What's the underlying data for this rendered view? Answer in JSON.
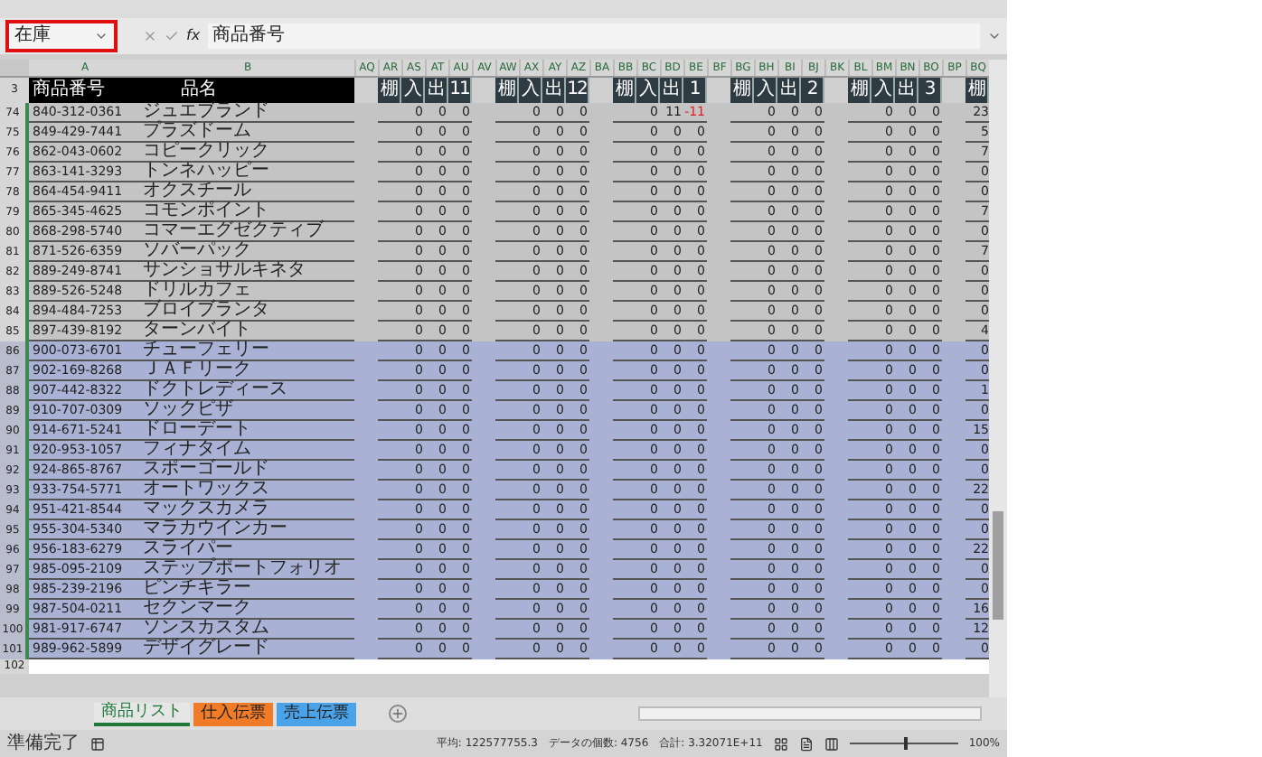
{
  "name_box": "在庫",
  "formula": {
    "fx": "fx",
    "value": "商品番号"
  },
  "columns": [
    "A",
    "B",
    "AQ",
    "AR",
    "AS",
    "AT",
    "AU",
    "AV",
    "AW",
    "AX",
    "AY",
    "AZ",
    "BA",
    "BB",
    "BC",
    "BD",
    "BE",
    "BF",
    "BG",
    "BH",
    "BI",
    "BJ",
    "BK",
    "BL",
    "BM",
    "BN",
    "BO",
    "BP",
    "BQ"
  ],
  "header": {
    "row": "3",
    "code": "商品番号",
    "name": "品名",
    "groups": [
      [
        "棚",
        "入",
        "出",
        "11"
      ],
      [
        "棚",
        "入",
        "出",
        "12"
      ],
      [
        "棚",
        "入",
        "出",
        "1"
      ],
      [
        "棚",
        "入",
        "出",
        "2"
      ],
      [
        "棚",
        "入",
        "出",
        "3"
      ]
    ],
    "last": "棚"
  },
  "rows": [
    {
      "num": "74",
      "code": "840-312-0361",
      "name": "ジュエブランド",
      "selected": false,
      "values": [
        [
          "0",
          "0",
          "0"
        ],
        [
          "0",
          "0",
          "0"
        ],
        [
          "0",
          "11",
          "-11"
        ],
        [
          "0",
          "0",
          "0"
        ],
        [
          "0",
          "0",
          "0"
        ]
      ],
      "red_values": [
        false,
        false,
        false,
        false,
        false,
        false,
        false,
        false,
        true,
        false,
        false,
        false,
        false,
        false,
        false
      ],
      "last": "23"
    },
    {
      "num": "75",
      "code": "849-429-7441",
      "name": "プラズドーム",
      "selected": false,
      "values": [
        [
          "0",
          "0",
          "0"
        ],
        [
          "0",
          "0",
          "0"
        ],
        [
          "0",
          "0",
          "0"
        ],
        [
          "0",
          "0",
          "0"
        ],
        [
          "0",
          "0",
          "0"
        ]
      ],
      "last": "5"
    },
    {
      "num": "76",
      "code": "862-043-0602",
      "name": "コピークリック",
      "selected": false,
      "values": [
        [
          "0",
          "0",
          "0"
        ],
        [
          "0",
          "0",
          "0"
        ],
        [
          "0",
          "0",
          "0"
        ],
        [
          "0",
          "0",
          "0"
        ],
        [
          "0",
          "0",
          "0"
        ]
      ],
      "last": "7"
    },
    {
      "num": "77",
      "code": "863-141-3293",
      "name": "トンネハッピー",
      "selected": false,
      "values": [
        [
          "0",
          "0",
          "0"
        ],
        [
          "0",
          "0",
          "0"
        ],
        [
          "0",
          "0",
          "0"
        ],
        [
          "0",
          "0",
          "0"
        ],
        [
          "0",
          "0",
          "0"
        ]
      ],
      "last": "0"
    },
    {
      "num": "78",
      "code": "864-454-9411",
      "name": "オクスチール",
      "selected": false,
      "values": [
        [
          "0",
          "0",
          "0"
        ],
        [
          "0",
          "0",
          "0"
        ],
        [
          "0",
          "0",
          "0"
        ],
        [
          "0",
          "0",
          "0"
        ],
        [
          "0",
          "0",
          "0"
        ]
      ],
      "last": "0"
    },
    {
      "num": "79",
      "code": "865-345-4625",
      "name": "コモンポイント",
      "selected": false,
      "values": [
        [
          "0",
          "0",
          "0"
        ],
        [
          "0",
          "0",
          "0"
        ],
        [
          "0",
          "0",
          "0"
        ],
        [
          "0",
          "0",
          "0"
        ],
        [
          "0",
          "0",
          "0"
        ]
      ],
      "last": "7"
    },
    {
      "num": "80",
      "code": "868-298-5740",
      "name": "コマーエグゼクティブ",
      "selected": false,
      "values": [
        [
          "0",
          "0",
          "0"
        ],
        [
          "0",
          "0",
          "0"
        ],
        [
          "0",
          "0",
          "0"
        ],
        [
          "0",
          "0",
          "0"
        ],
        [
          "0",
          "0",
          "0"
        ]
      ],
      "last": "0"
    },
    {
      "num": "81",
      "code": "871-526-6359",
      "name": "ソバーパック",
      "selected": false,
      "values": [
        [
          "0",
          "0",
          "0"
        ],
        [
          "0",
          "0",
          "0"
        ],
        [
          "0",
          "0",
          "0"
        ],
        [
          "0",
          "0",
          "0"
        ],
        [
          "0",
          "0",
          "0"
        ]
      ],
      "last": "7"
    },
    {
      "num": "82",
      "code": "889-249-8741",
      "name": "サンショサルキネタ",
      "selected": false,
      "values": [
        [
          "0",
          "0",
          "0"
        ],
        [
          "0",
          "0",
          "0"
        ],
        [
          "0",
          "0",
          "0"
        ],
        [
          "0",
          "0",
          "0"
        ],
        [
          "0",
          "0",
          "0"
        ]
      ],
      "last": "0"
    },
    {
      "num": "83",
      "code": "889-526-5248",
      "name": "ドリルカフェ",
      "selected": false,
      "values": [
        [
          "0",
          "0",
          "0"
        ],
        [
          "0",
          "0",
          "0"
        ],
        [
          "0",
          "0",
          "0"
        ],
        [
          "0",
          "0",
          "0"
        ],
        [
          "0",
          "0",
          "0"
        ]
      ],
      "last": "0"
    },
    {
      "num": "84",
      "code": "894-484-7253",
      "name": "ブロイブランタ",
      "selected": false,
      "values": [
        [
          "0",
          "0",
          "0"
        ],
        [
          "0",
          "0",
          "0"
        ],
        [
          "0",
          "0",
          "0"
        ],
        [
          "0",
          "0",
          "0"
        ],
        [
          "0",
          "0",
          "0"
        ]
      ],
      "last": "0"
    },
    {
      "num": "85",
      "code": "897-439-8192",
      "name": "ターンバイト",
      "selected": false,
      "values": [
        [
          "0",
          "0",
          "0"
        ],
        [
          "0",
          "0",
          "0"
        ],
        [
          "0",
          "0",
          "0"
        ],
        [
          "0",
          "0",
          "0"
        ],
        [
          "0",
          "0",
          "0"
        ]
      ],
      "last": "4"
    },
    {
      "num": "86",
      "code": "900-073-6701",
      "name": "チューフェリー",
      "selected": true,
      "values": [
        [
          "0",
          "0",
          "0"
        ],
        [
          "0",
          "0",
          "0"
        ],
        [
          "0",
          "0",
          "0"
        ],
        [
          "0",
          "0",
          "0"
        ],
        [
          "0",
          "0",
          "0"
        ]
      ],
      "last": "0"
    },
    {
      "num": "87",
      "code": "902-169-8268",
      "name": "ＪＡＦリーク",
      "selected": true,
      "values": [
        [
          "0",
          "0",
          "0"
        ],
        [
          "0",
          "0",
          "0"
        ],
        [
          "0",
          "0",
          "0"
        ],
        [
          "0",
          "0",
          "0"
        ],
        [
          "0",
          "0",
          "0"
        ]
      ],
      "last": "0"
    },
    {
      "num": "88",
      "code": "907-442-8322",
      "name": "ドクトレディース",
      "selected": true,
      "values": [
        [
          "0",
          "0",
          "0"
        ],
        [
          "0",
          "0",
          "0"
        ],
        [
          "0",
          "0",
          "0"
        ],
        [
          "0",
          "0",
          "0"
        ],
        [
          "0",
          "0",
          "0"
        ]
      ],
      "last": "1"
    },
    {
      "num": "89",
      "code": "910-707-0309",
      "name": "ソックピザ",
      "selected": true,
      "values": [
        [
          "0",
          "0",
          "0"
        ],
        [
          "0",
          "0",
          "0"
        ],
        [
          "0",
          "0",
          "0"
        ],
        [
          "0",
          "0",
          "0"
        ],
        [
          "0",
          "0",
          "0"
        ]
      ],
      "last": "0"
    },
    {
      "num": "90",
      "code": "914-671-5241",
      "name": "ドローデート",
      "selected": true,
      "values": [
        [
          "0",
          "0",
          "0"
        ],
        [
          "0",
          "0",
          "0"
        ],
        [
          "0",
          "0",
          "0"
        ],
        [
          "0",
          "0",
          "0"
        ],
        [
          "0",
          "0",
          "0"
        ]
      ],
      "last": "15"
    },
    {
      "num": "91",
      "code": "920-953-1057",
      "name": "フィナタイム",
      "selected": true,
      "values": [
        [
          "0",
          "0",
          "0"
        ],
        [
          "0",
          "0",
          "0"
        ],
        [
          "0",
          "0",
          "0"
        ],
        [
          "0",
          "0",
          "0"
        ],
        [
          "0",
          "0",
          "0"
        ]
      ],
      "last": "0"
    },
    {
      "num": "92",
      "code": "924-865-8767",
      "name": "スポーゴールド",
      "selected": true,
      "values": [
        [
          "0",
          "0",
          "0"
        ],
        [
          "0",
          "0",
          "0"
        ],
        [
          "0",
          "0",
          "0"
        ],
        [
          "0",
          "0",
          "0"
        ],
        [
          "0",
          "0",
          "0"
        ]
      ],
      "last": "0"
    },
    {
      "num": "93",
      "code": "933-754-5771",
      "name": "オートワックス",
      "selected": true,
      "values": [
        [
          "0",
          "0",
          "0"
        ],
        [
          "0",
          "0",
          "0"
        ],
        [
          "0",
          "0",
          "0"
        ],
        [
          "0",
          "0",
          "0"
        ],
        [
          "0",
          "0",
          "0"
        ]
      ],
      "last": "22"
    },
    {
      "num": "94",
      "code": "951-421-8544",
      "name": "マックスカメラ",
      "selected": true,
      "values": [
        [
          "0",
          "0",
          "0"
        ],
        [
          "0",
          "0",
          "0"
        ],
        [
          "0",
          "0",
          "0"
        ],
        [
          "0",
          "0",
          "0"
        ],
        [
          "0",
          "0",
          "0"
        ]
      ],
      "last": "0"
    },
    {
      "num": "95",
      "code": "955-304-5340",
      "name": "マラカウインカー",
      "selected": true,
      "values": [
        [
          "0",
          "0",
          "0"
        ],
        [
          "0",
          "0",
          "0"
        ],
        [
          "0",
          "0",
          "0"
        ],
        [
          "0",
          "0",
          "0"
        ],
        [
          "0",
          "0",
          "0"
        ]
      ],
      "last": "0"
    },
    {
      "num": "96",
      "code": "956-183-6279",
      "name": "スライパー",
      "selected": true,
      "values": [
        [
          "0",
          "0",
          "0"
        ],
        [
          "0",
          "0",
          "0"
        ],
        [
          "0",
          "0",
          "0"
        ],
        [
          "0",
          "0",
          "0"
        ],
        [
          "0",
          "0",
          "0"
        ]
      ],
      "last": "22"
    },
    {
      "num": "97",
      "code": "985-095-2109",
      "name": "ステップポートフォリオ",
      "selected": true,
      "values": [
        [
          "0",
          "0",
          "0"
        ],
        [
          "0",
          "0",
          "0"
        ],
        [
          "0",
          "0",
          "0"
        ],
        [
          "0",
          "0",
          "0"
        ],
        [
          "0",
          "0",
          "0"
        ]
      ],
      "last": "0"
    },
    {
      "num": "98",
      "code": "985-239-2196",
      "name": "ピンチキラー",
      "selected": true,
      "values": [
        [
          "0",
          "0",
          "0"
        ],
        [
          "0",
          "0",
          "0"
        ],
        [
          "0",
          "0",
          "0"
        ],
        [
          "0",
          "0",
          "0"
        ],
        [
          "0",
          "0",
          "0"
        ]
      ],
      "last": "0"
    },
    {
      "num": "99",
      "code": "987-504-0211",
      "name": "セクンマーク",
      "selected": true,
      "values": [
        [
          "0",
          "0",
          "0"
        ],
        [
          "0",
          "0",
          "0"
        ],
        [
          "0",
          "0",
          "0"
        ],
        [
          "0",
          "0",
          "0"
        ],
        [
          "0",
          "0",
          "0"
        ]
      ],
      "last": "16"
    },
    {
      "num": "100",
      "code": "981-917-6747",
      "name": "ソンスカスタム",
      "selected": true,
      "values": [
        [
          "0",
          "0",
          "0"
        ],
        [
          "0",
          "0",
          "0"
        ],
        [
          "0",
          "0",
          "0"
        ],
        [
          "0",
          "0",
          "0"
        ],
        [
          "0",
          "0",
          "0"
        ]
      ],
      "last": "12"
    },
    {
      "num": "101",
      "code": "989-962-5899",
      "name": "デザイグレード",
      "selected": true,
      "values": [
        [
          "0",
          "0",
          "0"
        ],
        [
          "0",
          "0",
          "0"
        ],
        [
          "0",
          "0",
          "0"
        ],
        [
          "0",
          "0",
          "0"
        ],
        [
          "0",
          "0",
          "0"
        ]
      ],
      "last": "0"
    }
  ],
  "partial_row": "102",
  "sheets": [
    {
      "label": "商品リスト",
      "selected": true,
      "color": "#e6e6e6"
    },
    {
      "label": "仕入伝票",
      "selected": false,
      "color": "#f07c28"
    },
    {
      "label": "売上伝票",
      "selected": false,
      "color": "#4aa3e8"
    }
  ],
  "status": {
    "ready": "準備完了",
    "average": "平均: 122577755.3",
    "count": "データの個数: 4756",
    "sum": "合計: 3.32071E+11",
    "zoom": "100%",
    "level": 0.5
  }
}
